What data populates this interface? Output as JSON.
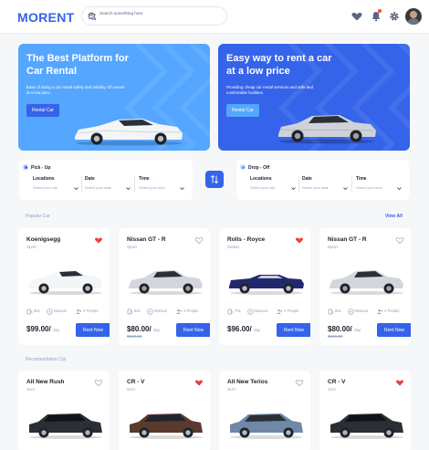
{
  "header": {
    "logo": "MORENT",
    "search_placeholder": "Search something here"
  },
  "banners": [
    {
      "title": "The Best Platform for Car Rental",
      "text": "Ease of doing a car rental safely and reliably. Of course at a low price.",
      "button": "Rental Car"
    },
    {
      "title": "Easy way to rent a car at a low price",
      "text": "Providing cheap car rental services and safe and comfortable facilities.",
      "button": "Rental Car"
    }
  ],
  "pickup": {
    "title": "Pick - Up",
    "fields": [
      {
        "label": "Locations",
        "value": "Select your city"
      },
      {
        "label": "Date",
        "value": "Select your date"
      },
      {
        "label": "Time",
        "value": "Select your time"
      }
    ]
  },
  "dropoff": {
    "title": "Drop - Off",
    "fields": [
      {
        "label": "Locations",
        "value": "Select your city"
      },
      {
        "label": "Date",
        "value": "Select your date"
      },
      {
        "label": "Time",
        "value": "Select your time"
      }
    ]
  },
  "popular": {
    "title": "Popular Car",
    "view_all": "View All",
    "cars": [
      {
        "name": "Koenigsegg",
        "type": "Sport",
        "fuel": "90L",
        "trans": "Manual",
        "people": "2 People",
        "price": "$99.00/",
        "per": "day",
        "old": "",
        "button": "Rent Now",
        "liked": true
      },
      {
        "name": "Nissan GT - R",
        "type": "Sport",
        "fuel": "80L",
        "trans": "Manual",
        "people": "2 People",
        "price": "$80.00/",
        "per": "day",
        "old": "$100.00",
        "button": "Rent Now",
        "liked": false
      },
      {
        "name": "Rolls - Royce",
        "type": "Sedan",
        "fuel": "70L",
        "trans": "Manual",
        "people": "4 People",
        "price": "$96.00/",
        "per": "day",
        "old": "",
        "button": "Rent Now",
        "liked": true
      },
      {
        "name": "Nissan GT - R",
        "type": "Sport",
        "fuel": "80L",
        "trans": "Manual",
        "people": "2 People",
        "price": "$80.00/",
        "per": "day",
        "old": "$100.00",
        "button": "Rent Now",
        "liked": false
      }
    ]
  },
  "recommendation": {
    "title": "Recomendation Car",
    "cars": [
      {
        "name": "All New Rush",
        "type": "SUV",
        "liked": false
      },
      {
        "name": "CR - V",
        "type": "SUV",
        "liked": true
      },
      {
        "name": "All New Terios",
        "type": "SUV",
        "liked": false
      },
      {
        "name": "CR - V",
        "type": "SUV",
        "liked": true
      }
    ]
  },
  "colors": {
    "primary": "#3563e9",
    "secondary": "#54a6ff",
    "heart": "#ed3f3f",
    "muted": "#90a3bf"
  }
}
